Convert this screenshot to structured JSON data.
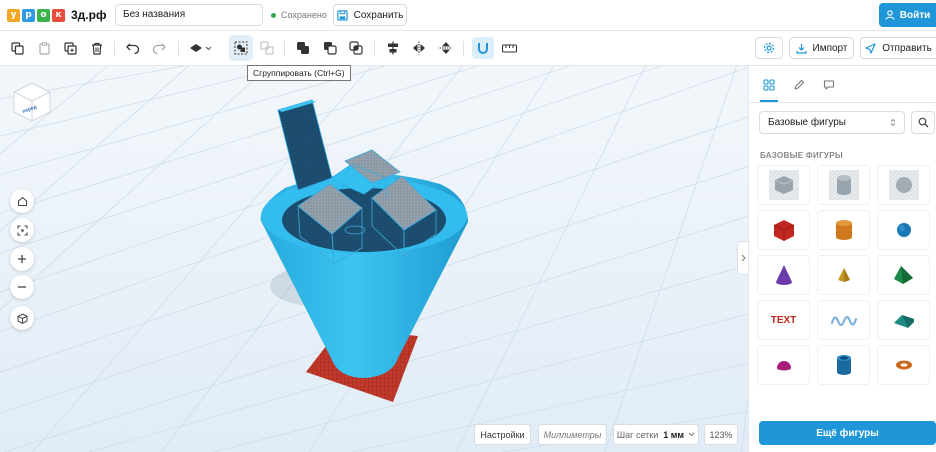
{
  "header": {
    "logo_letters": [
      "у",
      "р",
      "о",
      "к"
    ],
    "logo_colors": [
      "#f4a623",
      "#2f9be4",
      "#3bb24a",
      "#e74c3c"
    ],
    "logo_domain": "3д.рф",
    "project_title": "Без названия",
    "saved_status": "Сохранено",
    "save_label": "Сохранить",
    "login_label": "Войти"
  },
  "toolbar": {
    "tooltip": "Сгруппировать (Ctrl+G)",
    "icons": [
      "copy-icon",
      "paste-icon",
      "duplicate-icon",
      "delete-icon",
      "undo-icon",
      "redo-icon",
      "workplane-icon",
      "group-icon",
      "ungroup-icon",
      "union-icon",
      "subtract-icon",
      "intersect-icon",
      "align-icon",
      "mirror-icon",
      "flip-icon",
      "magnet-icon",
      "ruler-icon"
    ],
    "import_label": "Импорт",
    "send_label": "Отправить"
  },
  "viewport": {
    "viewcube_label": "перед",
    "settings_label": "Настройки",
    "units_label": "Миллиметры",
    "grid_step_label": "Шаг сетки",
    "grid_step_value": "1 мм",
    "zoom_label": "123%"
  },
  "panel": {
    "shape_category": "Базовые фигуры",
    "section_title": "БАЗОВЫЕ ФИГУРЫ",
    "text_shape_label": "TEXT",
    "more_label": "Ещё фигуры",
    "shapes": [
      "hole-box",
      "hole-cylinder",
      "hole-sphere",
      "box",
      "cylinder",
      "sphere",
      "cone",
      "pyramid",
      "roof",
      "text",
      "scribble",
      "wedge",
      "half-sphere",
      "tube",
      "torus"
    ]
  },
  "colors": {
    "accent": "#1e96d8",
    "model_blue": "#29b7ea",
    "workplane_red": "#c0392b"
  }
}
